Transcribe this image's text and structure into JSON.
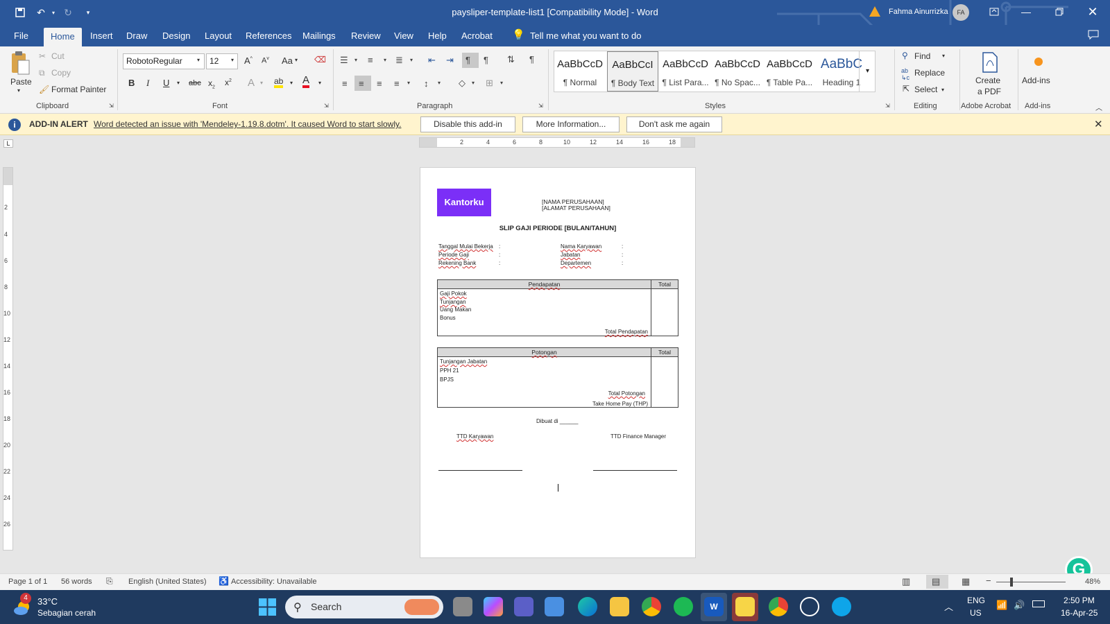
{
  "titlebar": {
    "doc_title": "paysliper-template-list1 [Compatibility Mode] - Word",
    "user_name": "Fahma Ainurrizka",
    "user_initials": "FA"
  },
  "tabs": [
    "File",
    "Home",
    "Insert",
    "Draw",
    "Design",
    "Layout",
    "References",
    "Mailings",
    "Review",
    "View",
    "Help",
    "Acrobat"
  ],
  "tell_me": "Tell me what you want to do",
  "clipboard": {
    "paste": "Paste",
    "cut": "Cut",
    "copy": "Copy",
    "format_painter": "Format Painter",
    "label": "Clipboard"
  },
  "font": {
    "name": "RobotoRegular",
    "size": "12",
    "label": "Font",
    "change_case": "Aa"
  },
  "paragraph": {
    "label": "Paragraph"
  },
  "styles": {
    "label": "Styles",
    "items": [
      {
        "sample": "AaBbCcD",
        "name": "¶ Normal"
      },
      {
        "sample": "AaBbCcI",
        "name": "¶ Body Text"
      },
      {
        "sample": "AaBbCcD",
        "name": "¶ List Para..."
      },
      {
        "sample": "AaBbCcD",
        "name": "¶ No Spac..."
      },
      {
        "sample": "AaBbCcD",
        "name": "¶ Table Pa..."
      },
      {
        "sample": "AaBbC",
        "name": "Heading 1"
      }
    ]
  },
  "editing": {
    "find": "Find",
    "replace": "Replace",
    "select": "Select",
    "label": "Editing"
  },
  "acrobat": {
    "create_pdf_1": "Create",
    "create_pdf_2": "a PDF",
    "label": "Adobe Acrobat"
  },
  "addins": {
    "button": "Add-ins",
    "label": "Add-ins"
  },
  "alert": {
    "title": "ADD-IN ALERT",
    "message": "Word detected an issue with 'Mendeley-1.19.8.dotm'. It caused Word to start slowly.",
    "btn_disable": "Disable this add-in",
    "btn_more": "More Information...",
    "btn_dont": "Don't ask me again"
  },
  "ruler": {
    "h_ticks": [
      "2",
      "4",
      "6",
      "8",
      "10",
      "12",
      "14",
      "16",
      "18"
    ],
    "v_ticks": [
      "2",
      "4",
      "6",
      "8",
      "10",
      "12",
      "14",
      "16",
      "18",
      "20",
      "22",
      "24",
      "26"
    ]
  },
  "doc": {
    "logo": "Kantorku",
    "company_name": "[NAMA PERUSAHAAN]",
    "company_address": "[ALAMAT PERUSAHAAN]",
    "title": "SLIP GAJI PERIODE [BULAN/TAHUN]",
    "left_fields": [
      "Tanggal Mulai Bekerja",
      "Periode Gaji",
      "Rekening Bank"
    ],
    "right_fields": [
      "Nama Karyawan",
      "Jabatan",
      "Departemen"
    ],
    "colon": ":",
    "income": {
      "header": "Pendapatan",
      "total_header": "Total",
      "rows": [
        "Gaji Pokok",
        "Tunjangan",
        "Uang Makan",
        "Bonus"
      ],
      "total": "Total Pendapatan"
    },
    "deductions": {
      "header": "Potongan",
      "total_header": "Total",
      "rows": [
        "Tunjangan Jabatan",
        "PPH 21",
        "BPJS"
      ],
      "total": "Total Potongan",
      "thp": "Take Home Pay (THP)"
    },
    "made_in": "Dibuat di ______",
    "sign_employee": "TTD Karyawan",
    "sign_finance": "TTD Finance Manager"
  },
  "status": {
    "page": "Page 1 of 1",
    "words": "56 words",
    "language": "English (United States)",
    "accessibility": "Accessibility: Unavailable",
    "zoom": "48%"
  },
  "taskbar": {
    "temp": "33°C",
    "weather": "Sebagian cerah",
    "weather_badge": "4",
    "search": "Search",
    "lang1": "ENG",
    "lang2": "US",
    "time": "2:50 PM",
    "date": "16-Apr-25"
  }
}
